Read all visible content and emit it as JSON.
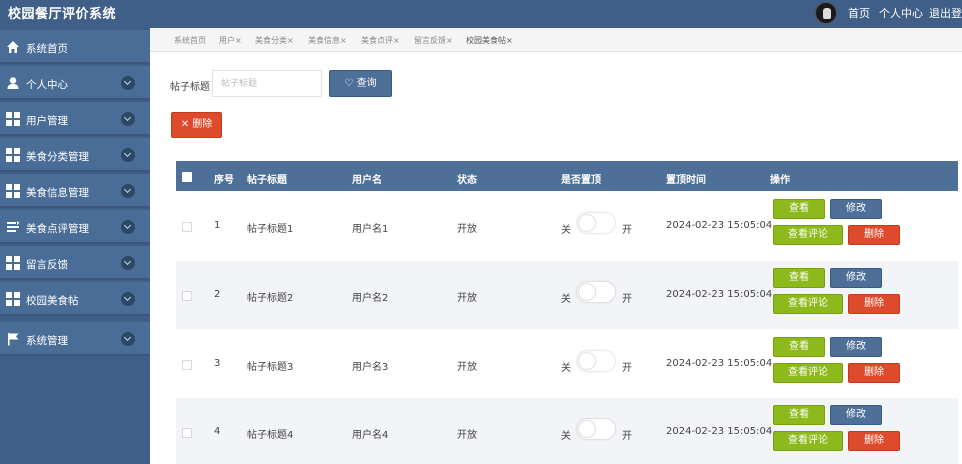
{
  "app": {
    "title": "校园餐厅评价系统"
  },
  "topnav": {
    "home": "首页",
    "profile": "个人中心",
    "logout": "退出登录"
  },
  "sidebar": {
    "items": [
      {
        "label": "系统首页",
        "icon": "home-icon"
      },
      {
        "label": "个人中心",
        "icon": "user-icon"
      },
      {
        "label": "用户管理",
        "icon": "grid-icon"
      },
      {
        "label": "美食分类管理",
        "icon": "grid-icon"
      },
      {
        "label": "美食信息管理",
        "icon": "grid-icon"
      },
      {
        "label": "美食点评管理",
        "icon": "list-sort-icon"
      },
      {
        "label": "留言反馈",
        "icon": "grid-icon"
      },
      {
        "label": "校园美食帖",
        "icon": "grid-icon"
      },
      {
        "label": "系统管理",
        "icon": "flag-icon"
      }
    ]
  },
  "tabs": [
    {
      "label": "系统首页",
      "closable": false
    },
    {
      "label": "用户×",
      "closable": true
    },
    {
      "label": "美食分类×",
      "closable": true
    },
    {
      "label": "美食信息×",
      "closable": true
    },
    {
      "label": "美食点评×",
      "closable": true
    },
    {
      "label": "留言反馈×",
      "closable": true
    },
    {
      "label": "校园美食帖×",
      "closable": true,
      "active": true
    }
  ],
  "search": {
    "label": "帖子标题",
    "placeholder": "帖子标题",
    "button": "♡ 查询"
  },
  "toolbar": {
    "delete_label": "✕ 删除"
  },
  "table": {
    "columns": [
      "序号",
      "帖子标题",
      "用户名",
      "状态",
      "是否置顶",
      "置顶时间",
      "操作"
    ],
    "rows": [
      {
        "index": "1",
        "title": "帖子标题1",
        "username": "用户名1",
        "status": "开放",
        "pinned": false,
        "pin_time": "2024-02-23 15:05:04"
      },
      {
        "index": "2",
        "title": "帖子标题2",
        "username": "用户名2",
        "status": "开放",
        "pinned": false,
        "pin_time": "2024-02-23 15:05:04"
      },
      {
        "index": "3",
        "title": "帖子标题3",
        "username": "用户名3",
        "status": "开放",
        "pinned": false,
        "pin_time": "2024-02-23 15:05:04"
      },
      {
        "index": "4",
        "title": "帖子标题4",
        "username": "用户名4",
        "status": "开放",
        "pinned": false,
        "pin_time": "2024-02-23 15:05:04"
      }
    ],
    "toggle": {
      "off": "关",
      "on": "开"
    },
    "actions": {
      "view": "查看",
      "edit": "修改",
      "view_comments": "查看评论",
      "delete": "删除"
    }
  },
  "colors": {
    "header": "#3f5f88",
    "sidebar": "#4a6d98",
    "primary": "#4e6f98",
    "success": "#8db91c",
    "danger": "#de4b2c"
  }
}
